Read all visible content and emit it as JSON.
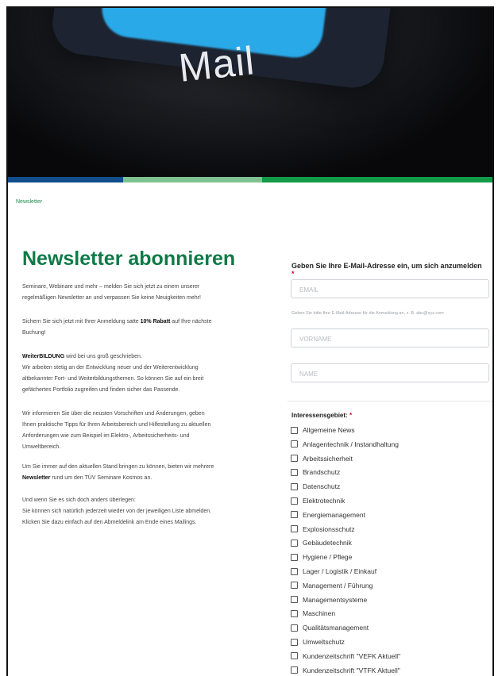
{
  "hero": {
    "word": "Mail"
  },
  "breadcrumb": "Newsletter",
  "title": "Newsletter abonnieren",
  "intro": {
    "p1": [
      "Seminare, Webinare und mehr – melden Sie sich jetzt zu einem unserer",
      "regelmäßigen Newsletter an und verpassen Sie keine Neuigkeiten mehr!"
    ],
    "p2_l1_a": "Sichern Sie sich jetzt mit Ihrer Anmeldung satte ",
    "p2_l1_b": "10% Rabatt",
    "p2_l1_c": " auf Ihre nächste",
    "p2_l2": "Buchung!",
    "p3_l1_a": "WeiterBILDUNG",
    "p3_l1_b": " wird bei uns groß geschrieben.",
    "p3_rest": [
      "Wir arbeiten stetig an der Entwicklung neuer und der Weiterentwicklung",
      "altbekannter Fort- und Weiterbildungsthemen. So können Sie auf ein breit",
      "gefächertes Portfolio zugreifen und finden sicher das Passende."
    ],
    "p4": [
      "Wir informieren Sie über die neusten Vorschriften und Änderungen, geben",
      "Ihnen praktische Tipps für Ihren Arbeitsbereich und Hilfestellung zu aktuellen",
      "Anforderungen wie zum Beispiel im Elektro-, Arbeitssicherheits- und",
      "Umweltbereich."
    ],
    "p5_l1": "Um Sie immer auf den aktuellen Stand bringen zu können, bieten wir mehrere",
    "p5_l2_a": "Newsletter",
    "p5_l2_b": " rund um den TÜV Seminare Kosmos an.",
    "p6": [
      "Und wenn Sie es sich doch anders überlegen:",
      "Sie können sich natürlich jederzeit wieder von der jeweiligen Liste abmelden.",
      "Klicken Sie dazu einfach auf den Abmeldelink am Ende eines Mailings."
    ]
  },
  "form": {
    "heading": "Geben Sie Ihre E-Mail-Adresse ein, um sich anzumelden",
    "required_mark": "*",
    "email_placeholder": "EMAIL",
    "email_hint": "Geben Sie bitte Ihre E-Mail-Adresse für die Anmeldung an, z. B. abc@xyz.com",
    "firstname_placeholder": "VORNAME",
    "lastname_placeholder": "NAME",
    "interest_label": "Interessensgebiet:",
    "interests": [
      "Allgemeine News",
      "Anlagentechnik / Instandhaltung",
      "Arbeitssicherheit",
      "Brandschutz",
      "Datenschutz",
      "Elektrotechnik",
      "Energiemanagement",
      "Explosionsschutz",
      "Gebäudetechnik",
      "Hygiene / Pflege",
      "Lager / Logistik / Einkauf",
      "Management / Führung",
      "Managementsysteme",
      "Maschinen",
      "Qualitätsmanagement",
      "Umweltschutz",
      "Kundenzeitschrift \"VEFK Aktuell\"",
      "Kundenzeitschrift \"VTFK Aktuell\""
    ]
  },
  "colors": {
    "brand_green": "#0e7a47",
    "stripe_blue": "#114e8c",
    "stripe_light_green": "#7ec290",
    "stripe_green": "#139a48",
    "required_red": "#dd0033"
  }
}
